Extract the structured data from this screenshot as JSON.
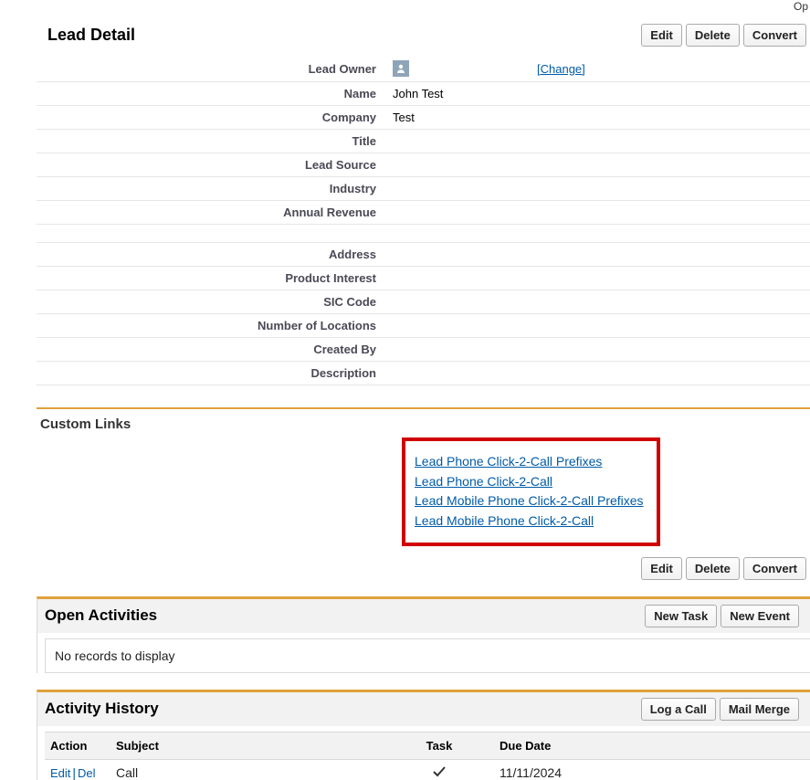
{
  "cornerText": "Op",
  "sectionTitle": "Lead Detail",
  "buttons": {
    "edit": "Edit",
    "delete": "Delete",
    "convert": "Convert",
    "newTask": "New Task",
    "newEvent": "New Event",
    "logCall": "Log a Call",
    "mailMerge": "Mail Merge"
  },
  "fields": {
    "leadOwner": {
      "label": "Lead Owner",
      "changeText": "[Change]"
    },
    "name": {
      "label": "Name",
      "value": "John Test"
    },
    "company": {
      "label": "Company",
      "value": "Test"
    },
    "title": {
      "label": "Title",
      "value": ""
    },
    "leadSource": {
      "label": "Lead Source",
      "value": ""
    },
    "industry": {
      "label": "Industry",
      "value": ""
    },
    "annualRevenue": {
      "label": "Annual Revenue",
      "value": ""
    },
    "address": {
      "label": "Address",
      "value": ""
    },
    "productInterest": {
      "label": "Product Interest",
      "value": ""
    },
    "sicCode": {
      "label": "SIC Code",
      "value": ""
    },
    "numLocations": {
      "label": "Number of Locations",
      "value": ""
    },
    "createdBy": {
      "label": "Created By",
      "value": ""
    },
    "description": {
      "label": "Description",
      "value": ""
    }
  },
  "customLinks": {
    "title": "Custom Links",
    "items": [
      "Lead Phone Click-2-Call Prefixes",
      "Lead Phone Click-2-Call",
      "Lead Mobile Phone Click-2-Call Prefixes",
      "Lead Mobile Phone Click-2-Call"
    ]
  },
  "openActivities": {
    "title": "Open Activities",
    "noRecords": "No records to display"
  },
  "activityHistory": {
    "title": "Activity History",
    "columns": {
      "action": "Action",
      "subject": "Subject",
      "task": "Task",
      "dueDate": "Due Date"
    },
    "rows": [
      {
        "editLabel": "Edit",
        "delLabel": "Del",
        "subject": "Call",
        "dueDate": "11/11/2024"
      }
    ]
  }
}
